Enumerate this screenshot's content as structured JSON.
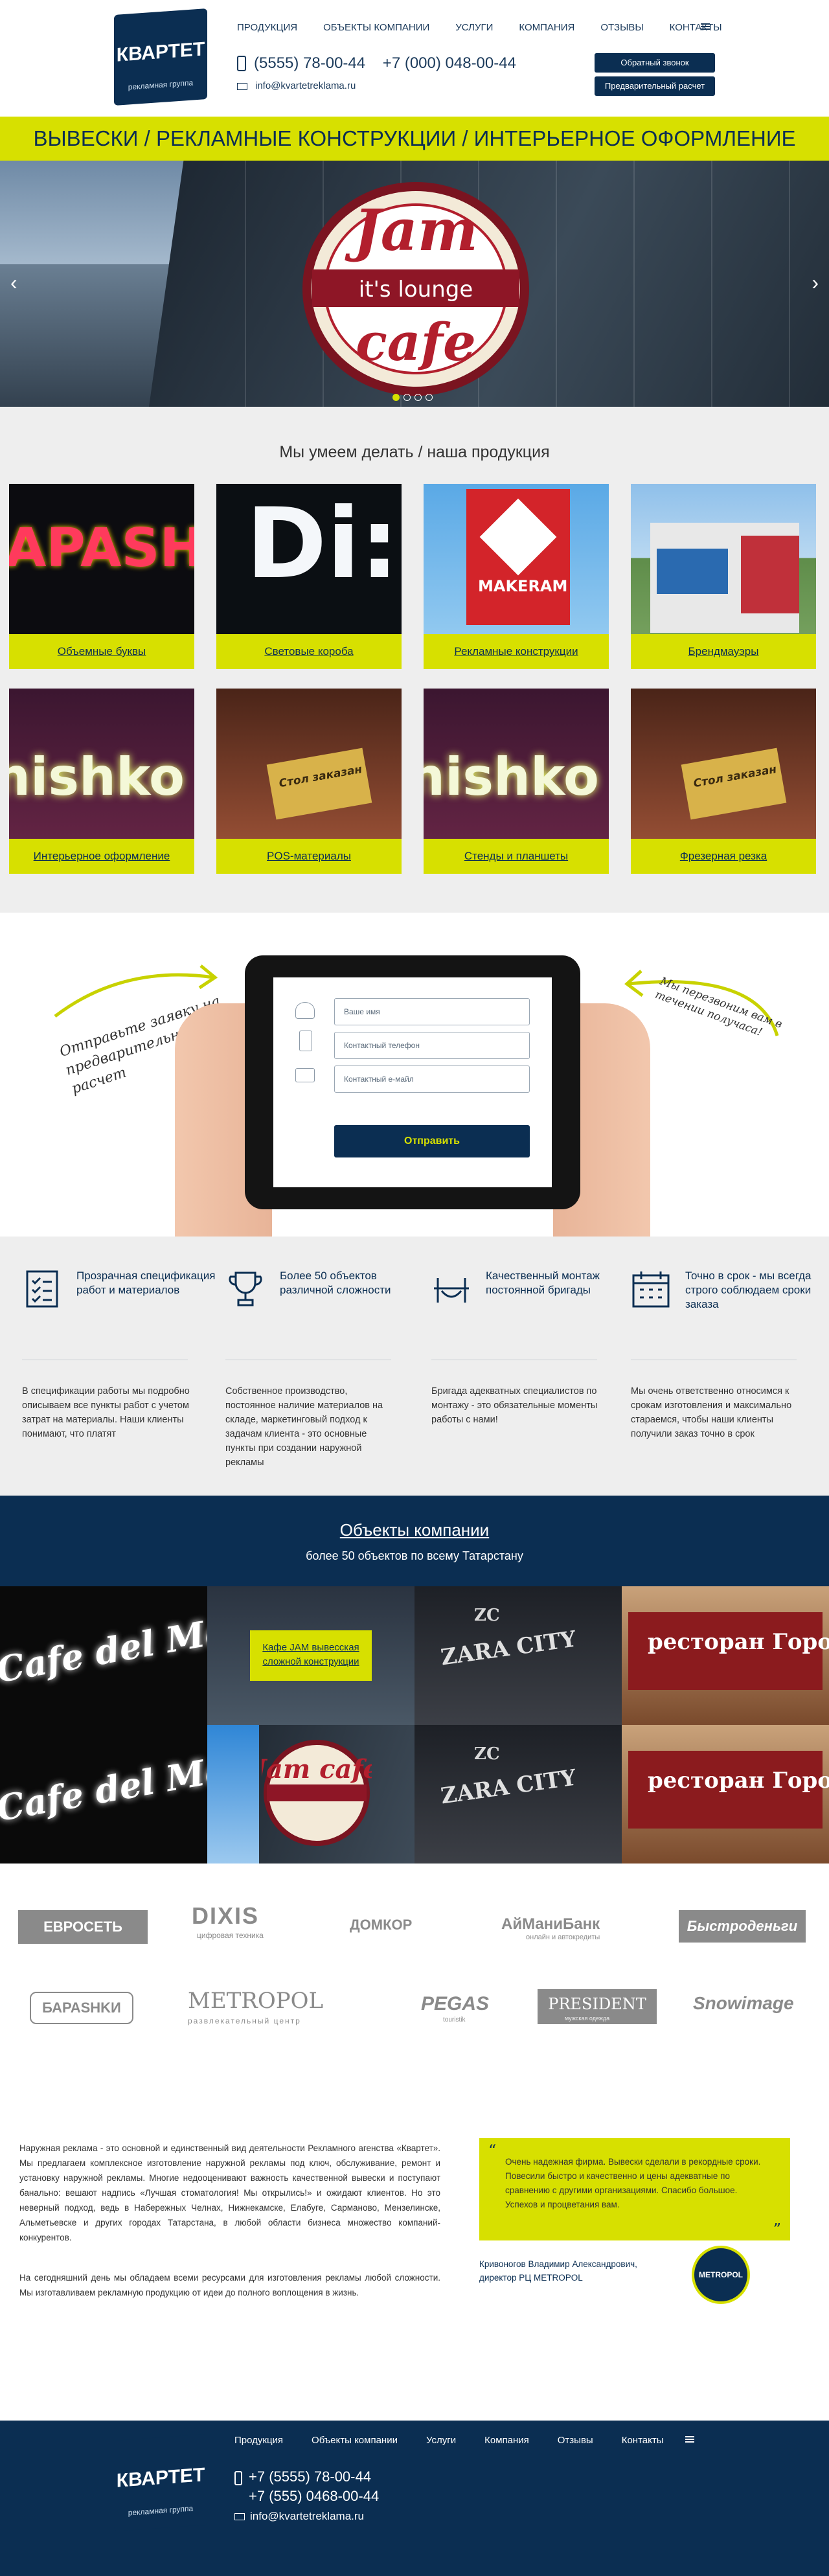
{
  "header": {
    "logo_text": "КВАРТЕТ",
    "logo_sub": "рекламная группа",
    "nav": [
      "ПРОДУКЦИЯ",
      "ОБЪЕКТЫ КОМПАНИИ",
      "УСЛУГИ",
      "КОМПАНИЯ",
      "ОТЗЫВЫ",
      "КОНТАКТЫ"
    ],
    "phone1": "(5555) 78-00-44",
    "phone2": "+7 (000) 048-00-44",
    "email": "info@kvartetreklama.ru",
    "btn_callback": "Обратный звонок",
    "btn_calc": "Предварительный расчет"
  },
  "tagline": "ВЫВЕСКИ  /  РЕКЛАМНЫЕ КОНСТРУКЦИИ  /  ИНТЕРЬЕРНОЕ ОФОРМЛЕНИЕ",
  "hero": {
    "sign_line1": "Jam",
    "sign_line2": "it's lounge",
    "sign_line3": "cafe",
    "prev_arrow": "‹",
    "next_arrow": "›",
    "active_slide": 1,
    "slide_count": 4
  },
  "products": {
    "title": "Мы умеем делать / наша продукция",
    "items": [
      {
        "label": "Объемные буквы",
        "art": "APASH"
      },
      {
        "label": "Световые короба",
        "art": "Di:S"
      },
      {
        "label": "Рекламные конструкции",
        "art": "MAKERAM"
      },
      {
        "label": "Брендмауэры",
        "art": ""
      },
      {
        "label": "Интерьерное оформление",
        "art": "nishko"
      },
      {
        "label": "POS-материалы",
        "art": "Стол заказан"
      },
      {
        "label": "Стенды и планшеты",
        "art": "nishko"
      },
      {
        "label": "Фрезерная резка",
        "art": "Стол заказан"
      }
    ]
  },
  "form": {
    "note_left": "Отправьте заявку на предварительный расчет",
    "note_right": "Мы перезвоним вам в течении получаса!",
    "name_placeholder": "Ваше имя",
    "phone_placeholder": "Контактный телефон",
    "email_placeholder": "Контактный е-майл",
    "submit": "Отправить"
  },
  "features": [
    {
      "title": "Прозрачная спецификация работ и материалов",
      "text": "В спецификации работы мы подробно описываем все пункты работ с учетом затрат на материалы. Наши клиенты понимают, что платят"
    },
    {
      "title": "Более 50 объектов различной сложности",
      "text": "Собственное производство, постоянное наличие материалов на складе, маркетинговый подход к задачам клиента - это основные пункты при создании наружной рекламы"
    },
    {
      "title": "Качественный монтаж постоянной бригады",
      "text": "Бригада адекватных специалистов по монтажу - это обязательные моменты работы с нами!"
    },
    {
      "title": "Точно в срок - мы всегда строго соблюдаем сроки заказа",
      "text": "Мы очень ответственно относимся к срокам изготовления и максимально стараемся, чтобы наши клиенты получили заказ точно в срок"
    }
  ],
  "objects": {
    "title": "Объекты компании",
    "subtitle": "более 50 объектов по всему Татарстану",
    "caption": "Кафе JAM вывесская сложной конструкции",
    "tiles": [
      "Cafe del Mar",
      "Jam cafe",
      "ZARA CITY",
      "ресторан Городище"
    ],
    "tile_zc": "ZC"
  },
  "partners": [
    "ЕВРОСЕТЬ",
    "DIXIS",
    "ДОМКОР",
    "АйМаниБанк",
    "Быстроденьги",
    "БАРАSHKИ",
    "METROPOL",
    "PEGAS",
    "PRESIDENT",
    "Snowimage"
  ],
  "partner_subs": {
    "dixis": "цифровая техника",
    "metropol": "развлекательный центр",
    "pegas": "touristik",
    "president": "мужская одежда",
    "aimani": "онлайн и автокредиты"
  },
  "about": {
    "p1": "Наружная реклама - это основной и единственный вид деятельности Рекламного агенства «Квартет». Мы предлагаем комплексное изготовление наружной рекламы под ключ, обслуживание, ремонт и установку наружной рекламы. Многие недооценивают важность качественной вывески и поступают банально: вешают надпись «Лучшая стоматология! Мы открылись!» и ожидают клиентов. Но это неверный подход, ведь в Набережных Челнах, Нижнекамске, Елабуге, Сарманово, Мензелинске, Альметьевске и других городах Татарстана, в любой области бизнеса множество компаний-конкурентов.",
    "p2": "На сегодняшний день мы обладаем всеми ресурсами для изготовления рекламы любой сложности. Мы изготавливаем рекламную продукцию от идеи до полного воплощения в жизнь.",
    "quote": "Очень надежная фирма. Вывески сделали в рекордные сроки. Повесили быстро и качественно и цены адекватные по сравнению с другими организациями. Спасибо большое. Успехов и процветания вам.",
    "author": "Кривоногов Владимир Александрович,",
    "author_role": "директор РЦ METROPOL",
    "avatar_text": "METROPOL"
  },
  "footer": {
    "nav": [
      "Продукция",
      "Объекты компании",
      "Услуги",
      "Компания",
      "Отзывы",
      "Контакты"
    ],
    "phone1": "+7 (5555) 78-00-44",
    "phone2": "+7 (555) 0468-00-44",
    "email": "info@kvartetreklama.ru"
  },
  "colors": {
    "brand_navy": "#0b2e52",
    "accent_yellow": "#d7e000"
  }
}
